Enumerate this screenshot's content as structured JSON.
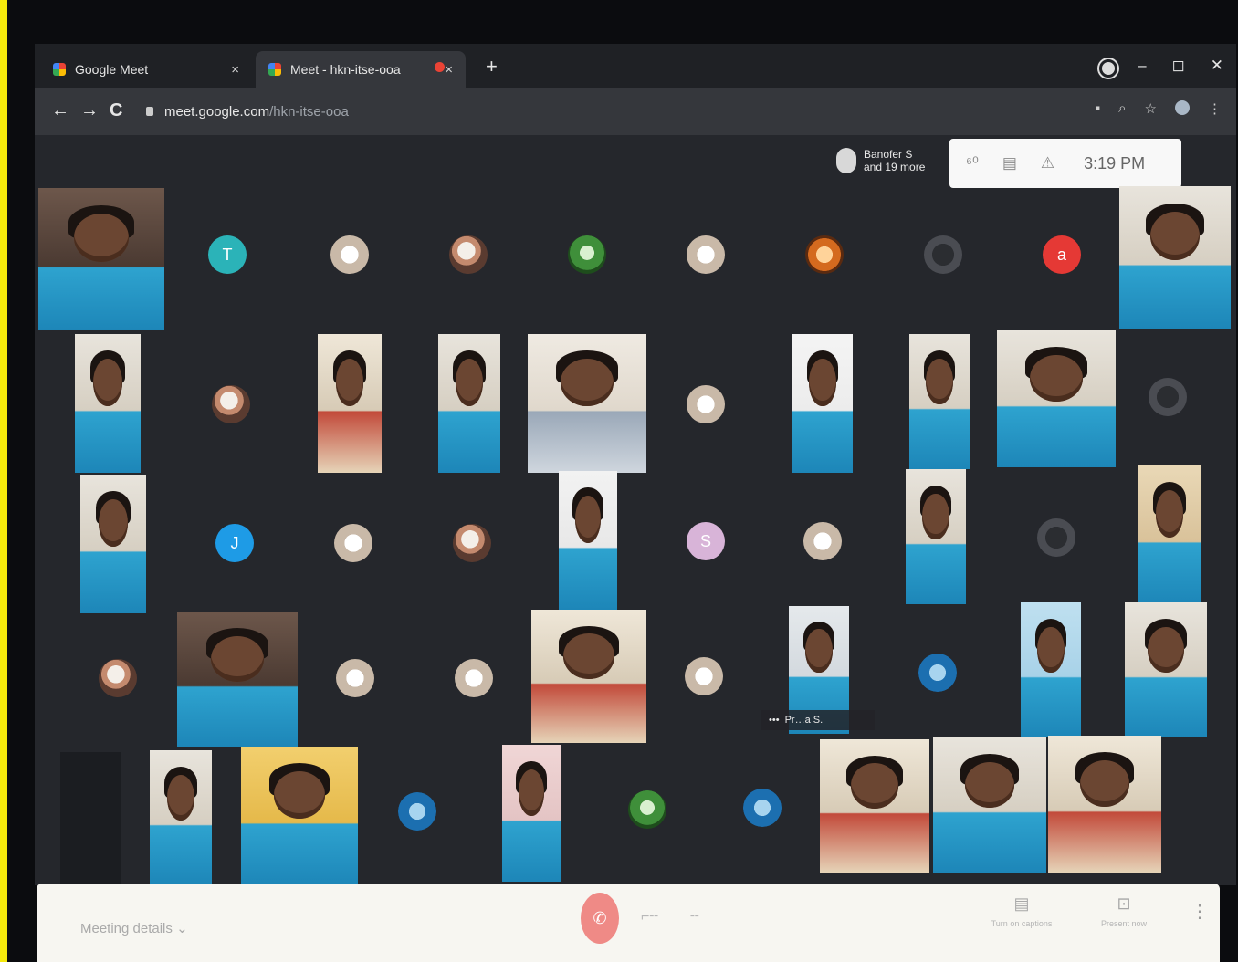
{
  "browser": {
    "tabs": [
      {
        "title": "Google Meet",
        "close": "×"
      },
      {
        "title": "Meet - hkn-itse-ooa",
        "close": "×"
      }
    ],
    "new_tab": "+",
    "window_controls": [
      "–",
      "◻",
      "✕"
    ],
    "url": {
      "host": "meet.google.com",
      "path": "/hkn-itse-ooa"
    },
    "nav": {
      "back": "←",
      "forward": "→",
      "reload": "C"
    },
    "omnibox_icons": [
      "▪",
      "⌕",
      "☆",
      "⋮"
    ]
  },
  "meet": {
    "presenter": {
      "name": "Banofer S",
      "more": "and 19 more"
    },
    "panel": {
      "people_count": "⁶⁰",
      "chat": "▤",
      "activities": "⚠",
      "time": "3:19 PM"
    },
    "avatars": [
      {
        "letter": "T",
        "color": "#2bb3b8"
      },
      {
        "letter": "a",
        "color": "#e53935"
      },
      {
        "letter": "J",
        "color": "#1e9be6"
      },
      {
        "letter": "S",
        "color": "#d8b4d8"
      }
    ],
    "pinned_name": "Pr…a S."
  },
  "bottom": {
    "meeting_details": "Meeting details",
    "details_chevron": "⌄",
    "leave": "✆",
    "captions": "Turn on captions",
    "present": "Present now",
    "more": "⋮"
  }
}
